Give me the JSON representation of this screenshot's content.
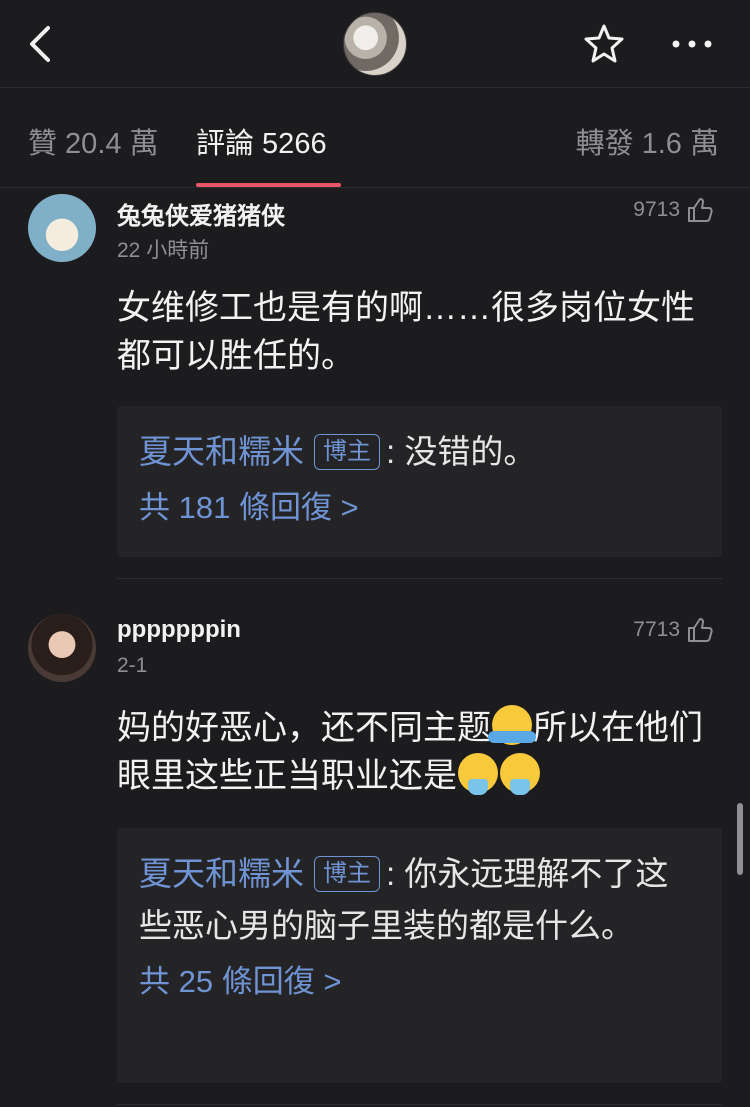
{
  "header": {
    "back_icon": "chevron-left-icon",
    "star_icon": "star-outline-icon",
    "more_icon": "more-horizontal-icon"
  },
  "tabs": {
    "likes": "贊 20.4 萬",
    "comments": "評論 5266",
    "reposts": "轉發 1.6 萬",
    "accent_color": "#ea5567"
  },
  "comments": [
    {
      "username": "兔兔侠爱猪猪侠",
      "time": "22 小時前",
      "likes": "9713",
      "text": "女维修工也是有的啊……很多岗位女性都可以胜任的。",
      "reply": {
        "author": "夏天和糯米",
        "badge": "博主",
        "text": ": 没错的。",
        "count": "共 181 條回復 >"
      }
    },
    {
      "username": "pppppppin",
      "time": "2-1",
      "likes": "7713",
      "text_a": "妈的好恶心，还不同主题",
      "text_b": "所以在他们眼里这些正当职业还是",
      "reply": {
        "author": "夏天和糯米",
        "badge": "博主",
        "text": ": 你永远理解不了这些恶心男的脑子里装的都是什么。",
        "count": "共 25 條回復 >"
      }
    }
  ],
  "colors": {
    "link": "#6f93d3",
    "background": "#1c1c1e"
  }
}
